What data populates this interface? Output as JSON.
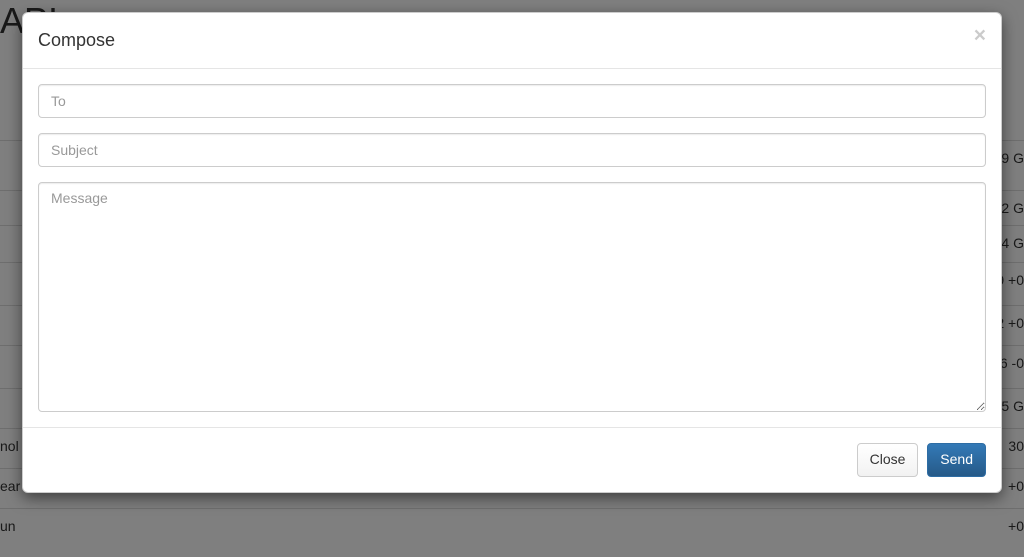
{
  "background": {
    "title": "API •",
    "rows": [
      {
        "left": "",
        "right": "9 G"
      },
      {
        "left": "",
        "right": "2 G"
      },
      {
        "left": "",
        "right": "4 G"
      },
      {
        "left": "",
        "right": "9 +0"
      },
      {
        "left": "",
        "right": "2 +0"
      },
      {
        "left": "",
        "right": "6 -0"
      },
      {
        "left": "",
        "right": "5 G"
      },
      {
        "left": "nol",
        "right": "30"
      },
      {
        "left": "ear",
        "right": "+0"
      },
      {
        "left": "un",
        "right": "+0"
      }
    ]
  },
  "modal": {
    "title": "Compose",
    "close_symbol": "×",
    "fields": {
      "to_placeholder": "To",
      "to_value": "",
      "subject_placeholder": "Subject",
      "subject_value": "",
      "message_placeholder": "Message",
      "message_value": ""
    },
    "buttons": {
      "close": "Close",
      "send": "Send"
    }
  }
}
